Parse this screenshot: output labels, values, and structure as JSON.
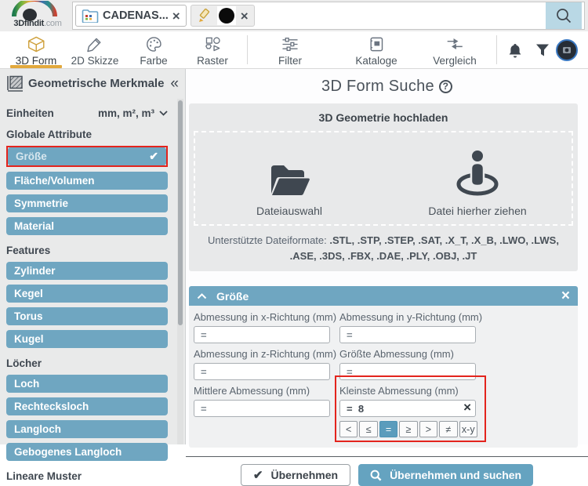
{
  "topbar": {
    "brand": {
      "p1": "3D",
      "p2": "findit",
      "p3": ".com"
    },
    "chip1_label": "CADENAS..."
  },
  "toolbar": {
    "tabs": [
      {
        "label": "3D Form"
      },
      {
        "label": "2D Skizze"
      },
      {
        "label": "Farbe"
      },
      {
        "label": "Raster"
      },
      {
        "label": "Filter"
      },
      {
        "label": "Kataloge"
      },
      {
        "label": "Vergleich"
      }
    ]
  },
  "sidebar": {
    "title": "Geometrische Merkmale",
    "units_label": "Einheiten",
    "units_value": "mm, m², m³",
    "groups": [
      {
        "heading": "Globale Attribute",
        "items": [
          {
            "label": "Größe",
            "selected": true
          },
          {
            "label": "Fläche/Volumen"
          },
          {
            "label": "Symmetrie"
          },
          {
            "label": "Material"
          }
        ]
      },
      {
        "heading": "Features",
        "items": [
          {
            "label": "Zylinder"
          },
          {
            "label": "Kegel"
          },
          {
            "label": "Torus"
          },
          {
            "label": "Kugel"
          }
        ]
      },
      {
        "heading": "Löcher",
        "items": [
          {
            "label": "Loch"
          },
          {
            "label": "Rechtecksloch"
          },
          {
            "label": "Langloch"
          },
          {
            "label": "Gebogenes Langloch"
          }
        ]
      },
      {
        "heading": "Lineare Muster",
        "items": []
      }
    ]
  },
  "main": {
    "title": "3D Form Suche",
    "upload": {
      "heading": "3D Geometrie hochladen",
      "file_select_label": "Dateiauswahl",
      "drag_label": "Datei hierher ziehen",
      "formats_prefix": "Unterstützte Dateiformate: ",
      "formats": ".STL, .STP, .STEP, .SAT, .X_T, .X_B, .LWO, .LWS, .ASE, .3DS, .FBX, .DAE, .PLY, .OBJ, .JT"
    },
    "size_panel": {
      "title": "Größe",
      "fields": [
        {
          "label": "Abmessung in x-Richtung (mm)",
          "value": "="
        },
        {
          "label": "Abmessung in y-Richtung (mm)",
          "value": "="
        },
        {
          "label": "Abmessung in z-Richtung (mm)",
          "value": "="
        },
        {
          "label": "Größte Abmessung (mm)",
          "value": "="
        },
        {
          "label": "Mittlere Abmessung (mm)",
          "value": "="
        },
        {
          "label": "Kleinste Abmessung (mm)",
          "value": "=  8"
        }
      ],
      "operators": [
        "<",
        "≤",
        "=",
        "≥",
        ">",
        "≠",
        "x-y"
      ],
      "selected_operator": "="
    },
    "actions": {
      "apply": "Übernehmen",
      "apply_search": "Übernehmen und suchen"
    }
  },
  "icons": {
    "check": "✔",
    "close": "×",
    "collapse": "«",
    "help": "?"
  },
  "colors": {
    "accent_blue": "#6fa6c1",
    "selected_blue": "#5b9cbc",
    "highlight_red": "#e3241d",
    "active_gold": "#e2a93d"
  }
}
